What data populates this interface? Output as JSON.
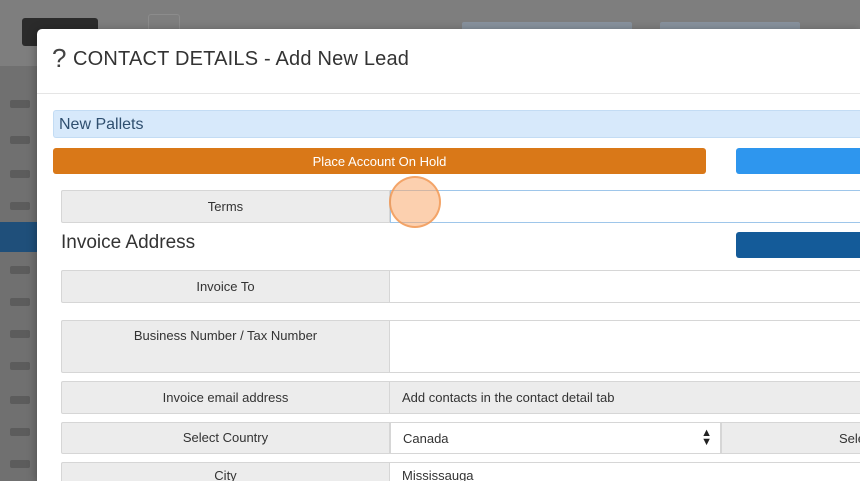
{
  "modal": {
    "help_icon": "?",
    "title": "CONTACT DETAILS - Add New Lead"
  },
  "company": {
    "name": "New Pallets"
  },
  "buttons": {
    "hold_label": "Place Account On Hold"
  },
  "terms": {
    "label": "Terms",
    "value": ""
  },
  "invoice_section": {
    "title": "Invoice Address",
    "rows": {
      "invoice_to": {
        "label": "Invoice To",
        "value": ""
      },
      "business_number": {
        "label": "Business Number / Tax Number",
        "value": ""
      },
      "invoice_email": {
        "label": "Invoice email address",
        "value": "Add contacts in the contact detail tab"
      },
      "country": {
        "label": "Select Country",
        "value": "Canada",
        "next_label": "Sele"
      },
      "city": {
        "label": "City",
        "value": "Mississauga"
      }
    }
  },
  "colors": {
    "hold_button": "#d97818",
    "blue_button": "#2e96ee",
    "dark_blue_button": "#145b99",
    "company_bar": "#d7e9fb"
  }
}
